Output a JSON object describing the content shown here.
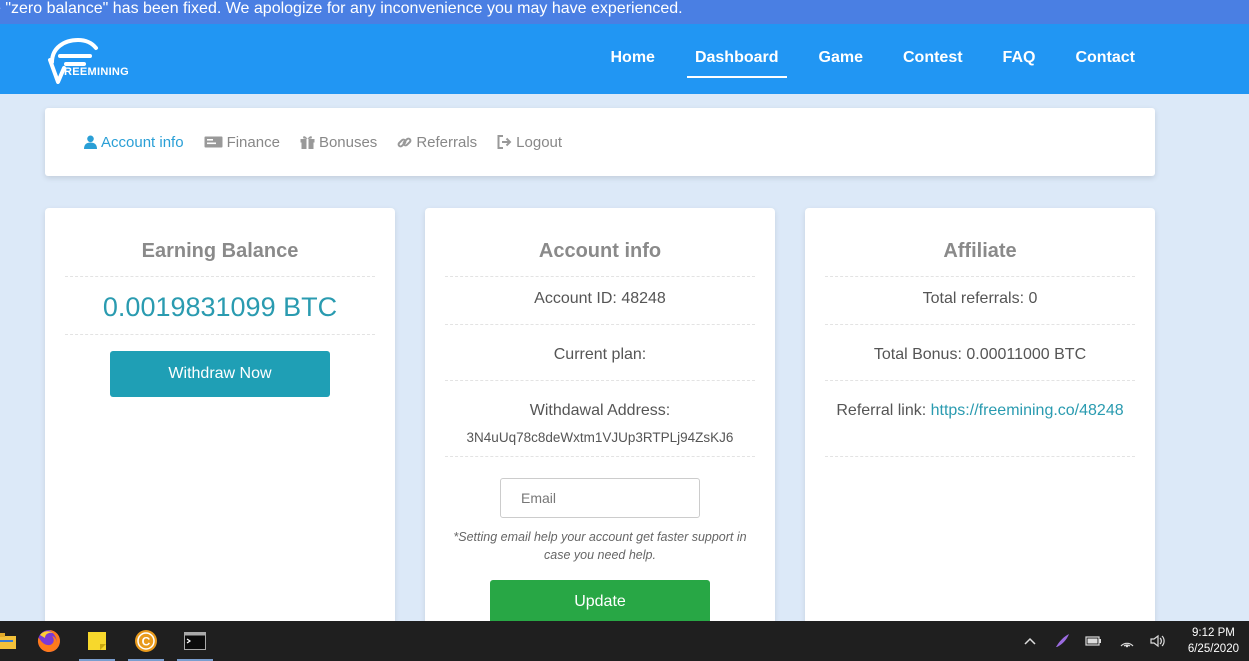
{
  "ticker": {
    "text": "e \"zero balance\" has been fixed. We apologize for any inconvenience you may have experienced."
  },
  "navbar": {
    "logo_text": "REEMINING",
    "links": [
      {
        "label": "Home",
        "active": false
      },
      {
        "label": "Dashboard",
        "active": true
      },
      {
        "label": "Game",
        "active": false
      },
      {
        "label": "Contest",
        "active": false
      },
      {
        "label": "FAQ",
        "active": false
      },
      {
        "label": "Contact",
        "active": false
      }
    ]
  },
  "subnav": {
    "items": [
      {
        "label": "Account info",
        "icon": "user-icon",
        "active": true
      },
      {
        "label": "Finance",
        "icon": "money-icon",
        "active": false
      },
      {
        "label": "Bonuses",
        "icon": "gift-icon",
        "active": false
      },
      {
        "label": "Referrals",
        "icon": "link-icon",
        "active": false
      },
      {
        "label": "Logout",
        "icon": "sign-out-icon",
        "active": false
      }
    ]
  },
  "earning": {
    "title": "Earning Balance",
    "balance": "0.0019831099 BTC",
    "withdraw_label": "Withdraw Now"
  },
  "account": {
    "title": "Account info",
    "account_id": "Account ID: 48248",
    "current_plan": "Current plan:",
    "withdrawal_label": "Withdawal Address:",
    "withdrawal_address": "3N4uUq78c8deWxtm1VJUp3RTPLj94ZsKJ6",
    "email_placeholder": "Email",
    "email_value": "",
    "note": "*Setting email help your account get faster support in case you need help.",
    "update_label": "Update"
  },
  "affiliate": {
    "title": "Affiliate",
    "total_referrals": "Total referrals: 0",
    "total_bonus": "Total Bonus: 0.00011000 BTC",
    "referral_label": "Referral link: ",
    "referral_link": "https://freemining.co/48248"
  },
  "taskbar": {
    "time": "9:12 PM",
    "date": "6/25/2020"
  },
  "colors": {
    "navbar": "#2196f3",
    "ticker": "#4a7fe3",
    "accent_teal": "#2a9bb0",
    "update_green": "#28a745",
    "page_bg": "#dce9f8"
  }
}
